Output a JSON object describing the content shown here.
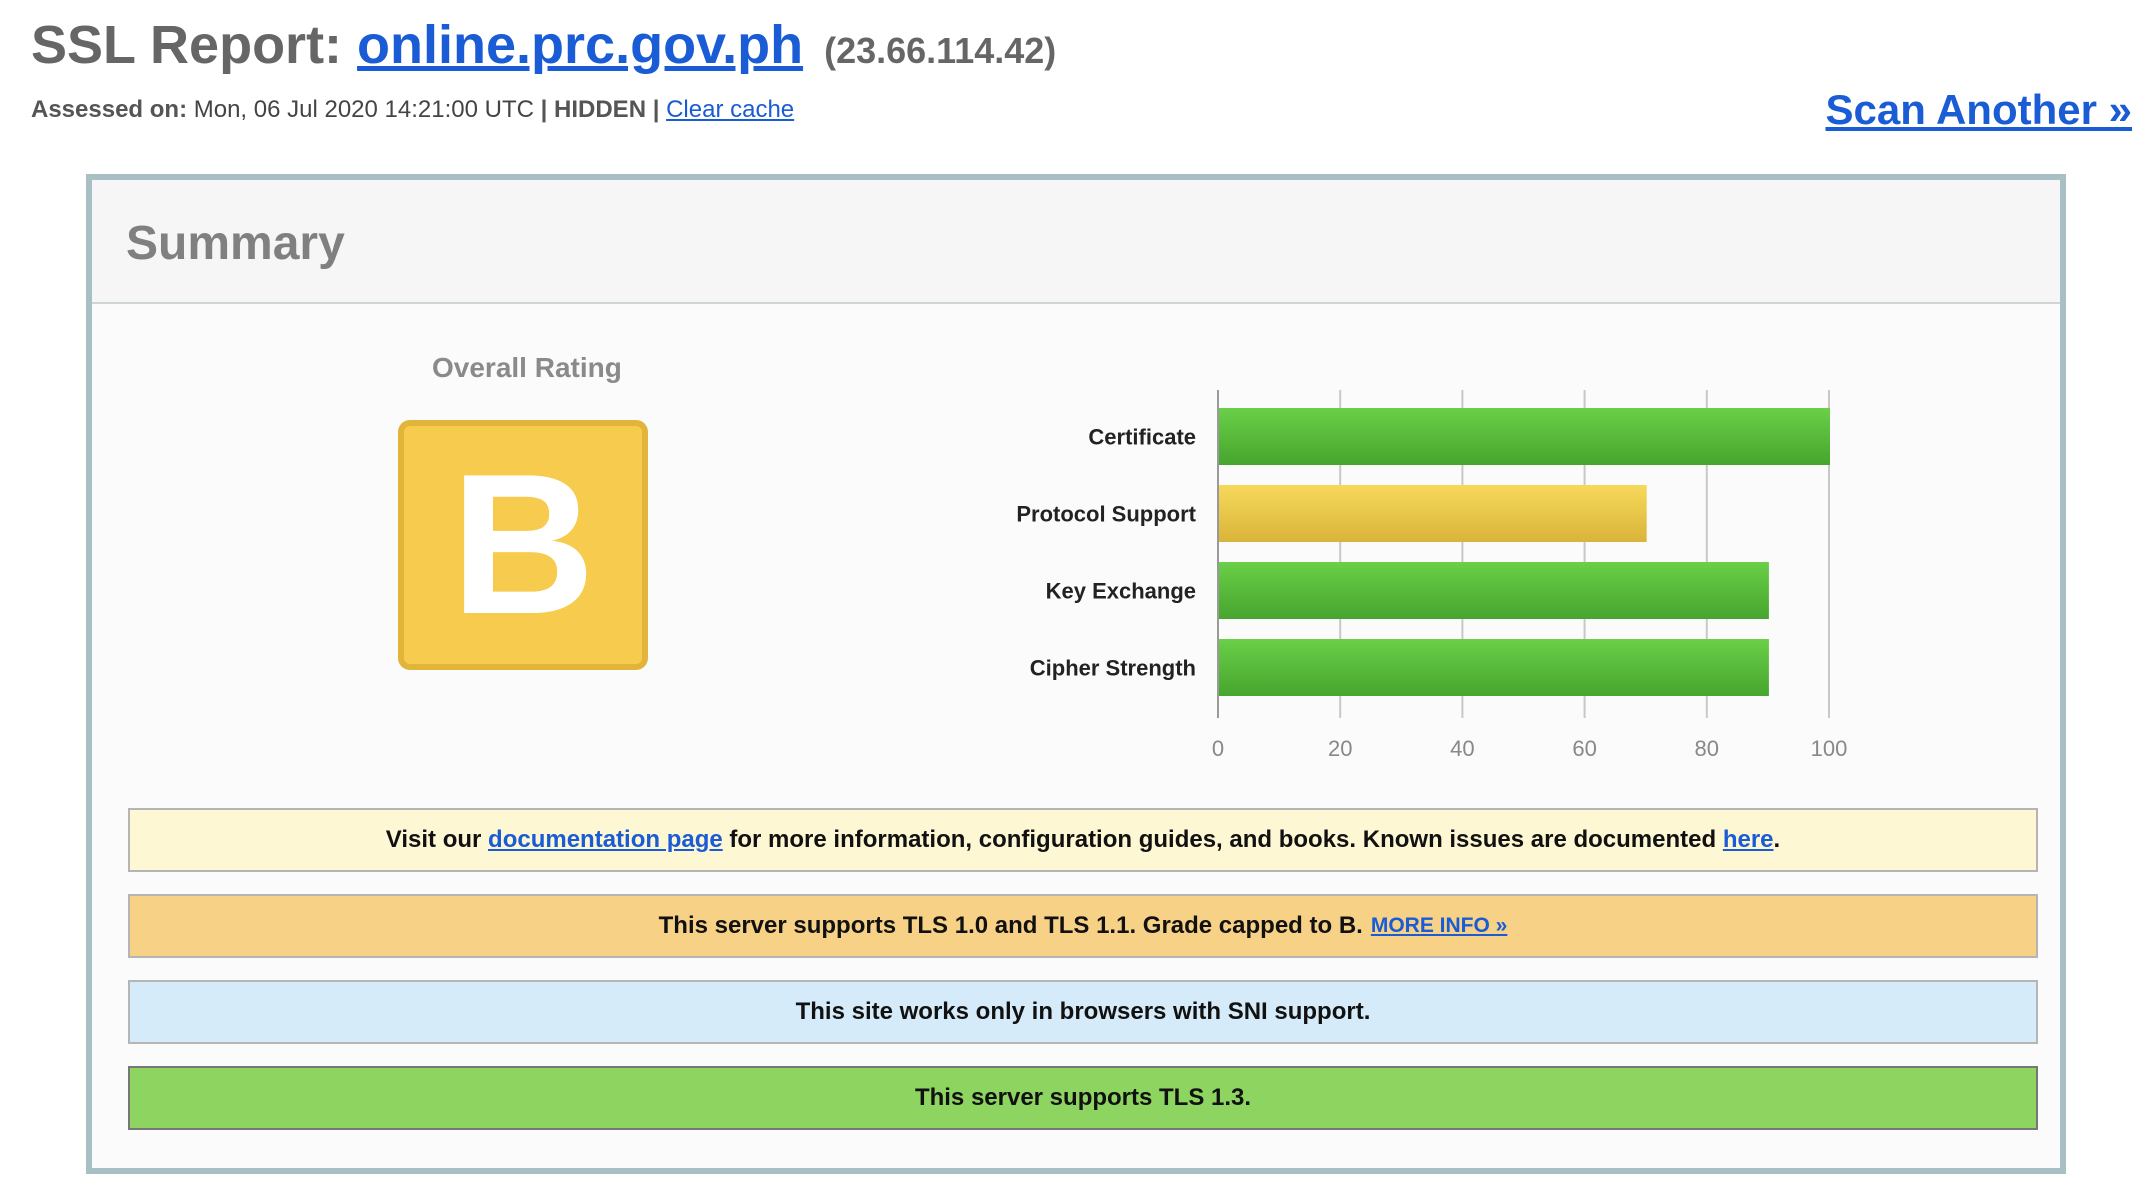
{
  "header": {
    "title_prefix": "SSL Report:",
    "host": "online.prc.gov.ph",
    "ip": "(23.66.114.42)",
    "assessed_label": "Assessed on:",
    "assessed_date": "Mon, 06 Jul 2020 14:21:00 UTC",
    "sep1": "|",
    "hidden": "HIDDEN",
    "sep2": "|",
    "clear_cache": "Clear cache",
    "scan_another": "Scan Another »"
  },
  "summary": {
    "title": "Summary",
    "overall_rating_label": "Overall Rating",
    "grade": "B",
    "grade_color": "#f7cb4d"
  },
  "chart_data": {
    "type": "bar",
    "orientation": "horizontal",
    "categories": [
      "Certificate",
      "Protocol Support",
      "Key Exchange",
      "Cipher Strength"
    ],
    "values": [
      100,
      70,
      90,
      90
    ],
    "colors": [
      "#56b83a",
      "#e6c243",
      "#56b83a",
      "#56b83a"
    ],
    "xlim": [
      0,
      100
    ],
    "xticks": [
      0,
      20,
      40,
      60,
      80,
      100
    ],
    "grid": true
  },
  "notices": {
    "doc": {
      "pre": "Visit our",
      "link1": "documentation page",
      "mid": "for more information, configuration guides, and books. Known issues are documented",
      "link2": "here",
      "post": "."
    },
    "tls": {
      "text": "This server supports TLS 1.0 and TLS 1.1. Grade capped to B.",
      "link": "MORE INFO »"
    },
    "sni": {
      "text": "This site works only in browsers with SNI support."
    },
    "tls13": {
      "text": "This server supports TLS 1.3."
    }
  }
}
